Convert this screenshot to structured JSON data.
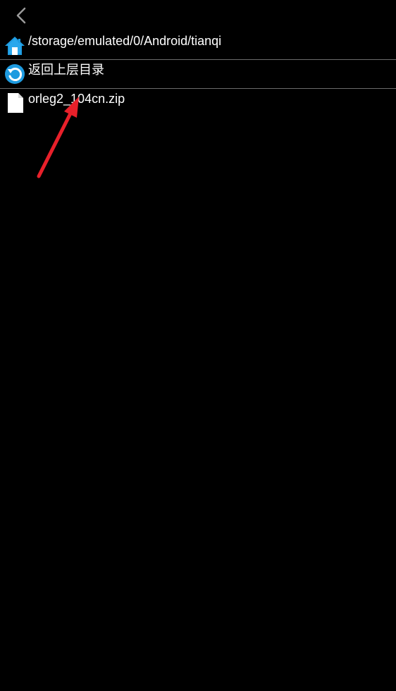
{
  "toolbar": {
    "back_icon": "chevron-left-icon"
  },
  "path_row": {
    "icon": "home-icon",
    "path": "/storage/emulated/0/Android/tianqi"
  },
  "up_row": {
    "icon": "refresh-back-icon",
    "label": "返回上层目录"
  },
  "files": [
    {
      "icon": "file-icon",
      "name": "orleg2_104cn.zip"
    }
  ],
  "colors": {
    "background": "#000000",
    "text": "#ffffff",
    "divider": "#6b6b6b",
    "accent_blue": "#1e9be0",
    "annotation_red": "#e8202a"
  }
}
